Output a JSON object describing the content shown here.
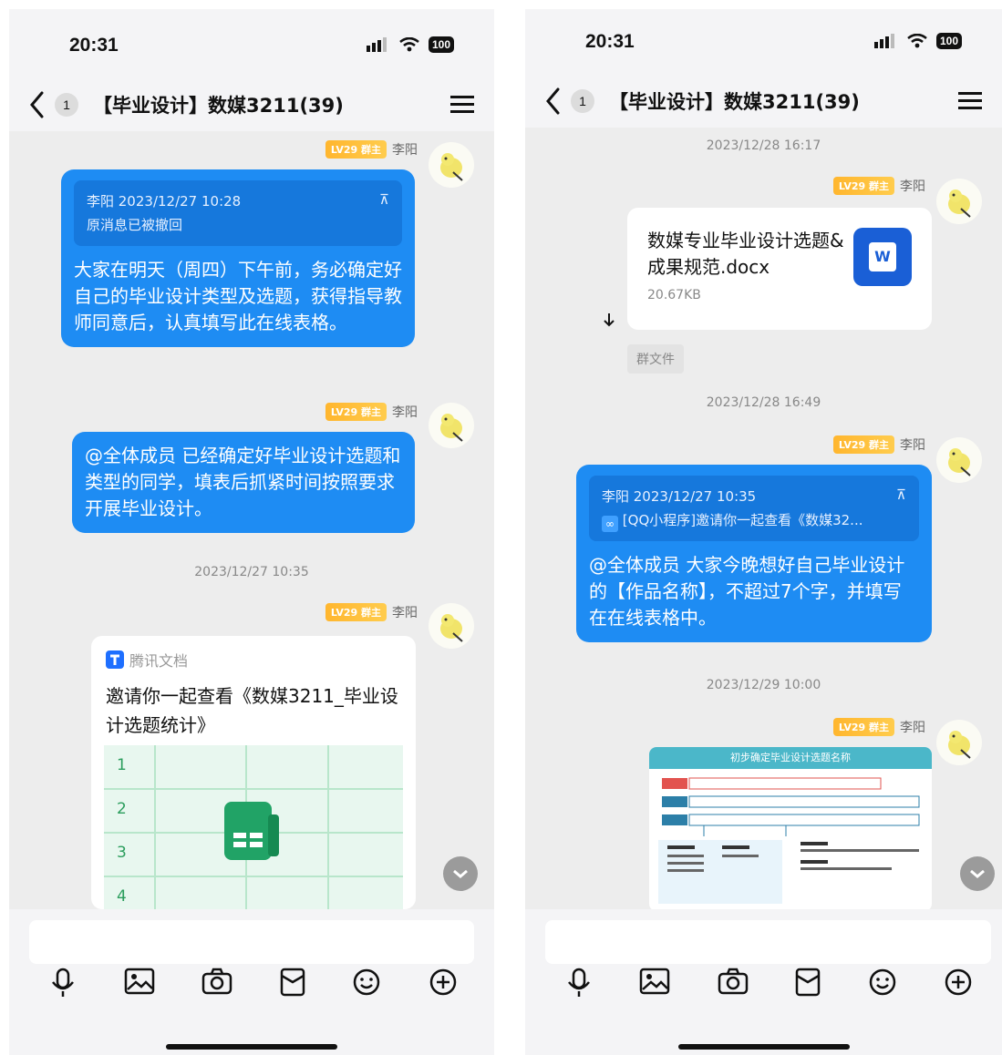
{
  "status": {
    "time": "20:31",
    "battery": "100"
  },
  "chat": {
    "unread_count": "1",
    "title": "【毕业设计】数媒3211(39)"
  },
  "sender": {
    "name": "李阳",
    "level": "LV29 群主"
  },
  "left": {
    "msg1": {
      "quote_header": "李阳 2023/12/27 10:28",
      "quote_text": "原消息已被撤回",
      "text": "大家在明天（周四）下午前，务必确定好自己的毕业设计类型及选题，获得指导教师同意后，认真填写此在线表格。"
    },
    "msg2": {
      "text": "@全体成员 已经确定好毕业设计选题和类型的同学，填表后抓紧时间按照要求开展毕业设计。"
    },
    "timestamp": "2023/12/27 10:35",
    "doc_card": {
      "source": "腾讯文档",
      "title": "邀请你一起查看《数媒3211_毕业设计选题统计》",
      "rows": [
        "1",
        "2",
        "3",
        "4"
      ]
    }
  },
  "right": {
    "timestamp1": "2023/12/28 16:17",
    "file": {
      "name": "数媒专业毕业设计选题&成果规范.docx",
      "size": "20.67KB",
      "icon_letter": "W",
      "tag": "群文件"
    },
    "timestamp2": "2023/12/28 16:49",
    "msg": {
      "quote_header": "李阳 2023/12/27 10:35",
      "quote_text": "[QQ小程序]邀请你一起查看《数媒32...",
      "text": "@全体成员 大家今晚想好自己毕业设计的【作品名称】，不超过7个字，并填写在在线表格中。"
    },
    "timestamp3": "2023/12/29 10:00",
    "image_title": "初步确定毕业设计选题名称"
  },
  "colors": {
    "bubble_blue": "#1e8cf3",
    "quote_blue": "#1678dc",
    "level_tag": "#ffb62e",
    "sheet_green": "#21a366",
    "word_blue": "#1a5fd6"
  },
  "icons": [
    "back-icon",
    "menu-icon",
    "voice-icon",
    "image-icon",
    "camera-icon",
    "red-packet-icon",
    "emoji-icon",
    "plus-icon",
    "download-icon",
    "link-icon",
    "chevron-down-icon"
  ]
}
